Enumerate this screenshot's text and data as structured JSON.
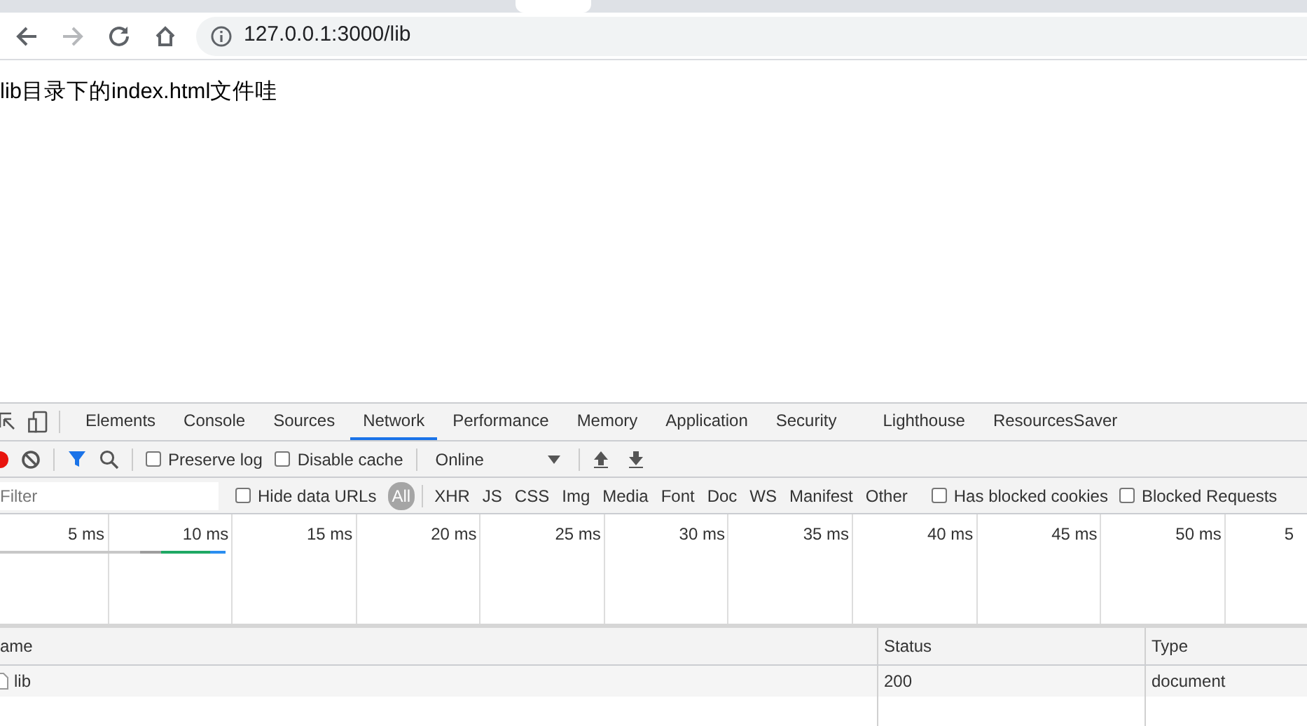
{
  "browser": {
    "back": {
      "disabled": false
    },
    "forward": {
      "disabled": true
    },
    "url": "127.0.0.1:3000/lib"
  },
  "page": {
    "text": "lib目录下的index.html文件哇"
  },
  "devtools": {
    "tabs": [
      {
        "label": "Elements",
        "selected": false
      },
      {
        "label": "Console",
        "selected": false
      },
      {
        "label": "Sources",
        "selected": false
      },
      {
        "label": "Network",
        "selected": true
      },
      {
        "label": "Performance",
        "selected": false
      },
      {
        "label": "Memory",
        "selected": false
      },
      {
        "label": "Application",
        "selected": false
      },
      {
        "label": "Security",
        "selected": false
      },
      {
        "label": "Lighthouse",
        "selected": false
      },
      {
        "label": "ResourcesSaver",
        "selected": false
      }
    ],
    "toolbar": {
      "recording": true,
      "filter_on": true,
      "preserve_log": {
        "label": "Preserve log",
        "checked": false
      },
      "disable_cache": {
        "label": "Disable cache",
        "checked": false
      },
      "throttling": "Online"
    },
    "filter": {
      "placeholder": "Filter",
      "hide_data_urls": {
        "label": "Hide data URLs",
        "checked": false
      },
      "types": [
        {
          "label": "All",
          "selected": true
        },
        {
          "label": "XHR",
          "selected": false
        },
        {
          "label": "JS",
          "selected": false
        },
        {
          "label": "CSS",
          "selected": false
        },
        {
          "label": "Img",
          "selected": false
        },
        {
          "label": "Media",
          "selected": false
        },
        {
          "label": "Font",
          "selected": false
        },
        {
          "label": "Doc",
          "selected": false
        },
        {
          "label": "WS",
          "selected": false
        },
        {
          "label": "Manifest",
          "selected": false
        },
        {
          "label": "Other",
          "selected": false
        }
      ],
      "has_blocked_cookies": {
        "label": "Has blocked cookies",
        "checked": false
      },
      "blocked_requests": {
        "label": "Blocked Requests",
        "checked": false
      }
    },
    "timeline": {
      "ticks": [
        "5 ms",
        "10 ms",
        "15 ms",
        "20 ms",
        "25 ms",
        "30 ms",
        "35 ms",
        "40 ms",
        "45 ms",
        "50 ms",
        "5"
      ]
    },
    "table": {
      "columns": [
        "ame",
        "Status",
        "Type"
      ],
      "rows": [
        {
          "cells": [
            "lib",
            "200",
            "document"
          ]
        }
      ]
    }
  }
}
